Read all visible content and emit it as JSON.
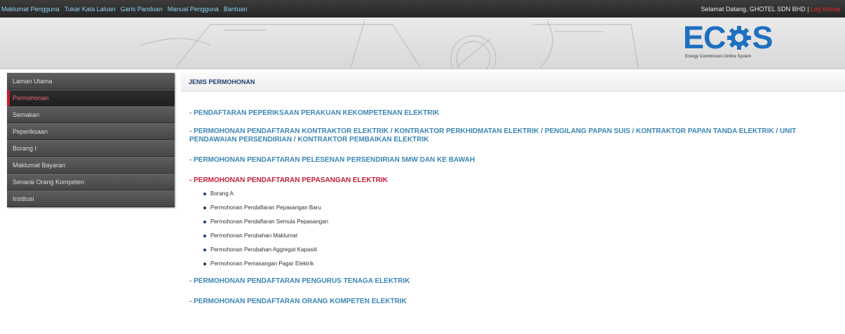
{
  "topbar": {
    "nav": [
      "Maklumat Pengguna",
      "Tukar Kata Laluan",
      "Garis Panduan",
      "Manual Pengguna",
      "Bantuan"
    ],
    "welcome": "Selamat Datang, GHOTEL SDN BHD |",
    "logout": "Log Keluar"
  },
  "banner": {
    "logo_text_left": "EC",
    "logo_text_right": "S",
    "logo_subtitle": "Energy Commission Online System",
    "logo_color": "#1f6fc0"
  },
  "sidebar": {
    "items": [
      {
        "label": "Laman Utama"
      },
      {
        "label": "Permohonan",
        "active": true
      },
      {
        "label": "Semakan"
      },
      {
        "label": "Peperiksaan"
      },
      {
        "label": "Borang I"
      },
      {
        "label": "Maklumat Bayaran"
      },
      {
        "label": "Senarai Orang Kompeten"
      },
      {
        "label": "Institusi"
      }
    ]
  },
  "content": {
    "heading": "JENIS PERMOHONAN",
    "sections": [
      {
        "label": "- PENDAFTARAN PEPERIKSAAN PERAKUAN KEKOMPETENAN ELEKTRIK"
      },
      {
        "label": "- PERMOHONAN PENDAFTARAN KONTRAKTOR ELEKTRIK / KONTRAKTOR PERKHIDMATAN ELEKTRIK / PENGILANG PAPAN SUIS / KONTRAKTOR PAPAN TANDA ELEKTRIK / UNIT PENDAWAIAN PERSENDIRIAN / KONTRAKTOR PEMBAIKAN ELEKTRIK"
      },
      {
        "label": "- PERMOHONAN PENDAFTARAN PELESENAN PERSENDIRIAN 5MW DAN KE BAWAH"
      },
      {
        "label": "- PERMOHONAN PENDAFTARAN PEPASANGAN ELEKTRIK",
        "active": true,
        "subitems": [
          "Borang A",
          "Permohonan Pendaftaran Pepasangan Baru",
          "Permohonan Pendaftaran Semula Pepasangan",
          "Permohonan Perubahan Maklumat",
          "Permohonan Perubahan Aggregat Kapasiti",
          "Permohonan Pemasangan Pagar Elektrik"
        ]
      },
      {
        "label": "- PERMOHONAN PENDAFTARAN PENGURUS TENAGA ELEKTRIK"
      },
      {
        "label": "- PERMOHONAN PENDAFTARAN ORANG KOMPETEN ELEKTRIK"
      }
    ],
    "colors": {
      "link": "#3a86b4",
      "active_link": "#c41e3a"
    }
  }
}
